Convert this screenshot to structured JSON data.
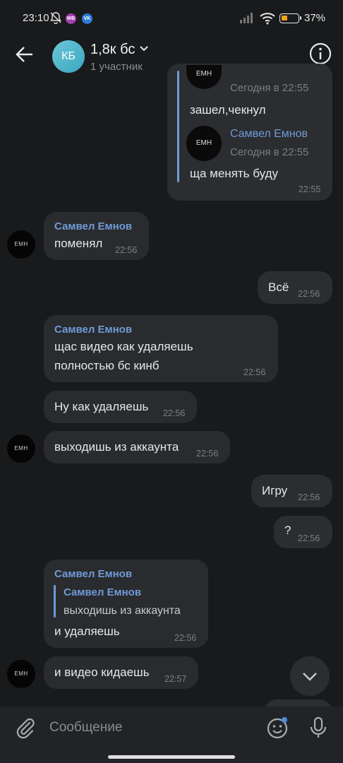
{
  "status": {
    "time": "23:10",
    "wb": "WB",
    "vk": "VK",
    "battery": "37%",
    "battery_level": 0.37
  },
  "header": {
    "avatar_initials": "КБ",
    "title": "1,8к бс",
    "subtitle": "1 участник"
  },
  "avatars": {
    "user": "EMH"
  },
  "messages": {
    "fwd_top": {
      "partial_date": "Сегодня в 22:55",
      "text1": "зашел,чекнул",
      "fwd_name": "Самвел Емнов",
      "fwd_date": "Сегодня в 22:55",
      "text2": "ща менять буду",
      "time": "22:55"
    },
    "m1": {
      "sender": "Самвел Емнов",
      "text": "поменял",
      "time": "22:56"
    },
    "m2": {
      "text": "Всё",
      "time": "22:56"
    },
    "m3": {
      "sender": "Самвел Емнов",
      "line1": "щас видео как удаляешь",
      "line2": "полностью бс кинб",
      "time": "22:56"
    },
    "m4": {
      "text": "Ну как удаляешь",
      "time": "22:56"
    },
    "m5": {
      "text": "выходишь из аккаунта",
      "time": "22:56"
    },
    "m6": {
      "text": "Игру",
      "time": "22:56"
    },
    "m7": {
      "text": "?",
      "time": "22:56"
    },
    "m8": {
      "sender": "Самвел Емнов",
      "reply_name": "Самвел Емнов",
      "reply_text": "выходишь из аккаунта",
      "text": "и удаляешь",
      "time": "22:56"
    },
    "m9": {
      "text": "и видео кидаешь",
      "time": "22:57"
    }
  },
  "composer": {
    "placeholder": "Сообщение"
  }
}
